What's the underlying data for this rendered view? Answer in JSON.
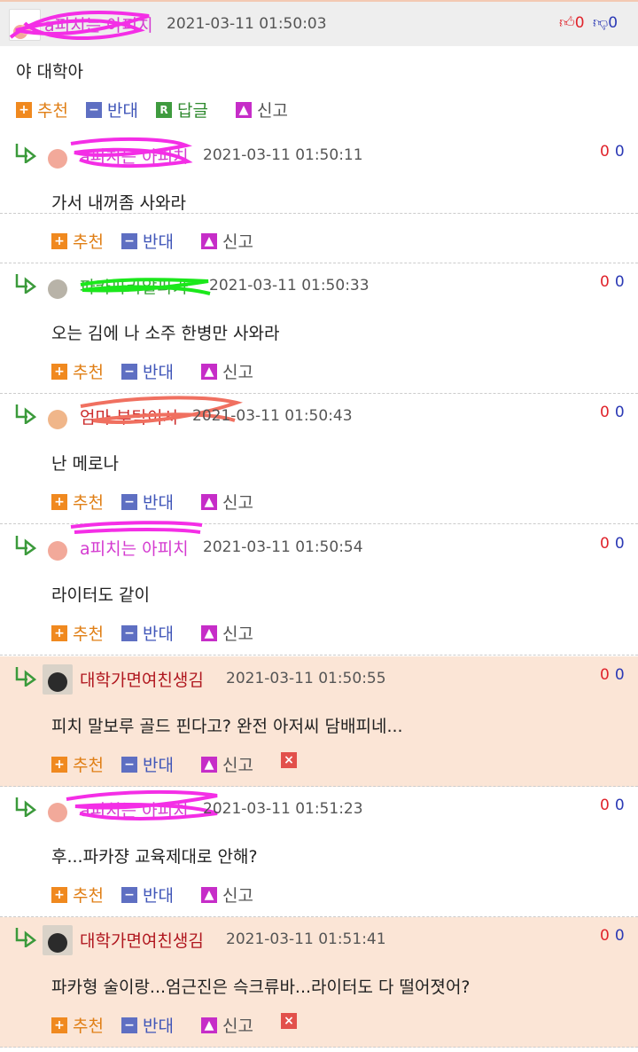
{
  "top": {
    "nick": "a피치는 아피치",
    "date": "2021-03-11 01:50:03",
    "body": "야 대학아",
    "up": "0",
    "down": "0",
    "rec_label": "추천",
    "opp_label": "반대",
    "reply_label": "답글",
    "report_label": "신고"
  },
  "replies": [
    {
      "nick": "a피치는 아피치",
      "date": "2021-03-11 01:50:11",
      "body": "가서 내꺼좀 사와라",
      "up": "0",
      "down": "0"
    },
    {
      "nick": "파카파카알파카",
      "date": "2021-03-11 01:50:33",
      "body": "오는 김에 나 소주 한병만 사와라",
      "up": "0",
      "down": "0"
    },
    {
      "nick": "엄마 부탁이시",
      "date": "2021-03-11 01:50:43",
      "body": "난 메로나",
      "up": "0",
      "down": "0"
    },
    {
      "nick": "a피치는 아피치",
      "date": "2021-03-11 01:50:54",
      "body": "라이터도 같이",
      "up": "0",
      "down": "0"
    },
    {
      "nick": "대학가면여친생김",
      "date": "2021-03-11 01:50:55",
      "body": "피치 말보루 골드 핀다고? 완전 아저씨 담배피네...",
      "up": "0",
      "down": "0"
    },
    {
      "nick": "a피치는 아피치",
      "date": "2021-03-11 01:51:23",
      "body": "후...파카쟝 교육제대로 안해?",
      "up": "0",
      "down": "0"
    },
    {
      "nick": "대학가면여친생김",
      "date": "2021-03-11 01:51:41",
      "body": "파카형 술이랑...엄근진은 슥크류바...라이터도 다 떨어졋어?",
      "up": "0",
      "down": "0"
    }
  ],
  "labels": {
    "rec": "추천",
    "opp": "반대",
    "report": "신고"
  }
}
